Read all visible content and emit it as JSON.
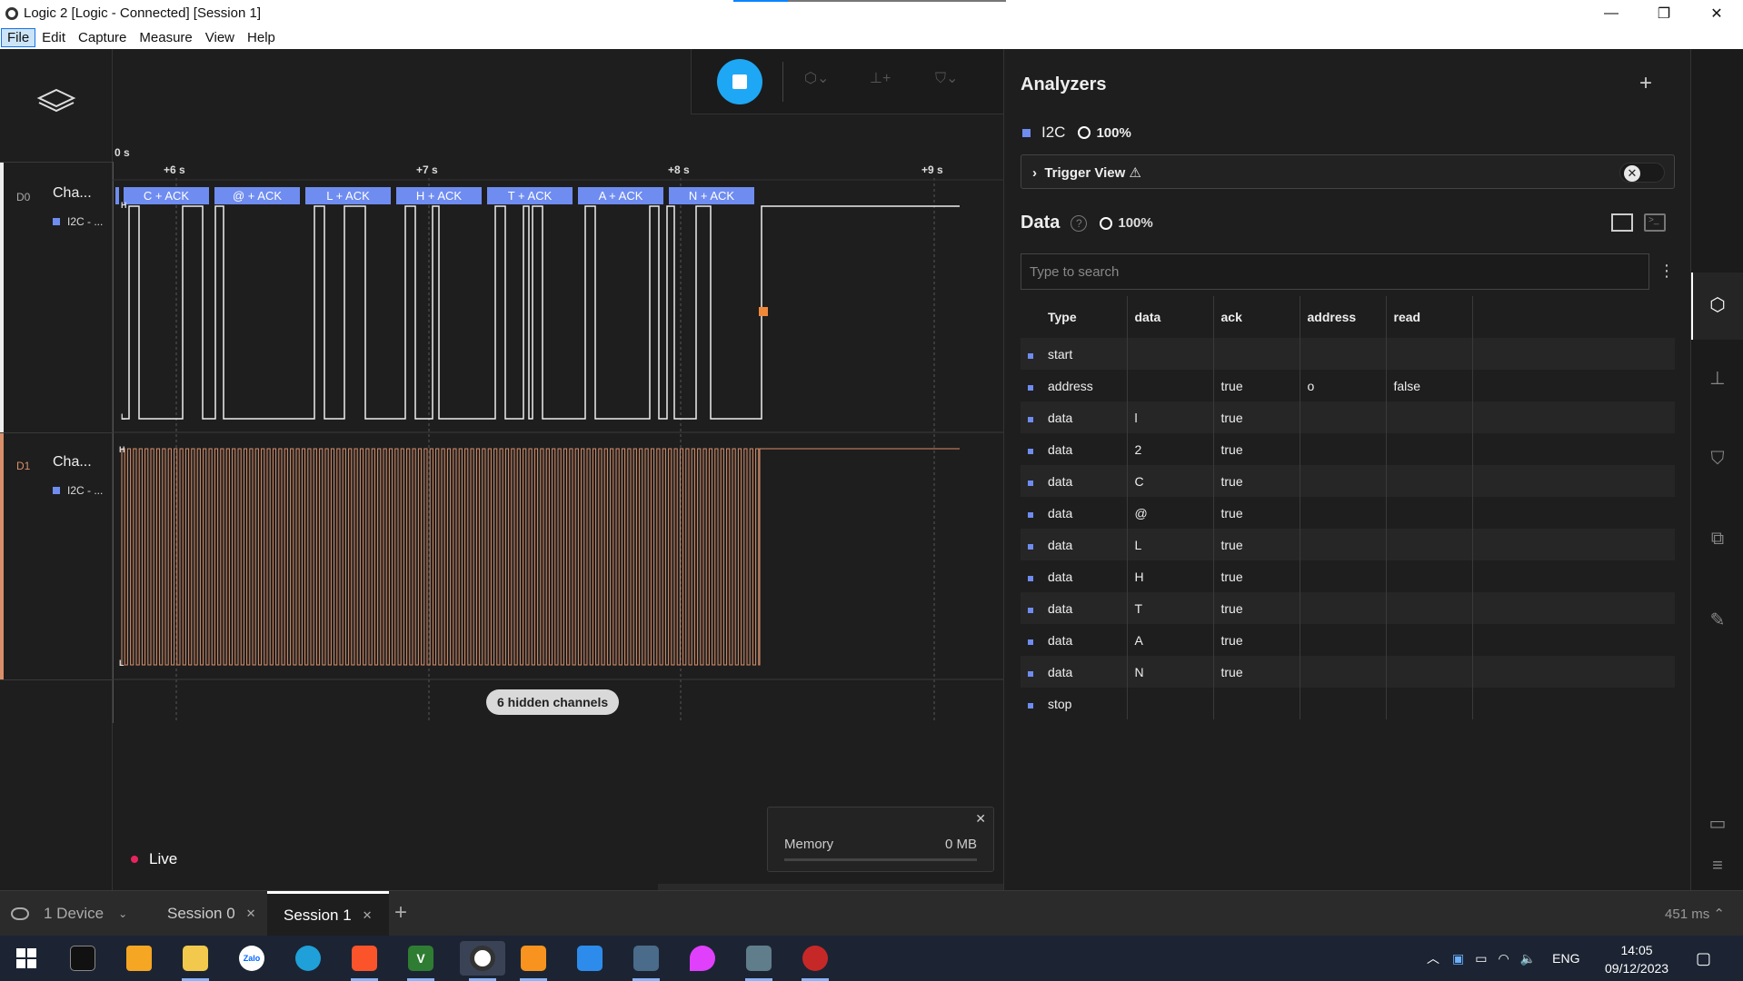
{
  "window": {
    "title": "Logic 2 [Logic - Connected] [Session 1]",
    "controls": [
      "—",
      "❐",
      "✕"
    ]
  },
  "menu": [
    "File",
    "Edit",
    "Capture",
    "Measure",
    "View",
    "Help"
  ],
  "timeline": {
    "origin_label": "0 s",
    "ticks": [
      "+6 s",
      "+7 s",
      "+8 s",
      "+9 s"
    ]
  },
  "channels": [
    {
      "id": "D0",
      "name": "Cha...",
      "analyzer": "I2C - ...",
      "color": "#ffffff"
    },
    {
      "id": "D1",
      "name": "Cha...",
      "analyzer": "I2C - ...",
      "color": "#d98f6a"
    }
  ],
  "decoded_frames": [
    "C + ACK",
    "@ + ACK",
    "L + ACK",
    "H + ACK",
    "T + ACK",
    "A + ACK",
    "N + ACK"
  ],
  "level_labels": {
    "high": "H",
    "low": "L"
  },
  "hidden_channels": "6 hidden channels",
  "live_label": "Live",
  "memory": {
    "label": "Memory",
    "value": "0 MB"
  },
  "analyzers": {
    "title": "Analyzers",
    "items": [
      {
        "name": "I2C",
        "progress": "100%"
      }
    ],
    "trigger_view": "Trigger View ⚠",
    "data_title": "Data",
    "data_progress": "100%",
    "search_placeholder": "Type to search",
    "columns": [
      "Type",
      "data",
      "ack",
      "address",
      "read"
    ],
    "rows": [
      [
        "start",
        "",
        "",
        "",
        ""
      ],
      [
        "address",
        "",
        "true",
        "o",
        "false"
      ],
      [
        "data",
        "l",
        "true",
        "",
        ""
      ],
      [
        "data",
        "2",
        "true",
        "",
        ""
      ],
      [
        "data",
        "C",
        "true",
        "",
        ""
      ],
      [
        "data",
        "@",
        "true",
        "",
        ""
      ],
      [
        "data",
        "L",
        "true",
        "",
        ""
      ],
      [
        "data",
        "H",
        "true",
        "",
        ""
      ],
      [
        "data",
        "T",
        "true",
        "",
        ""
      ],
      [
        "data",
        "A",
        "true",
        "",
        ""
      ],
      [
        "data",
        "N",
        "true",
        "",
        ""
      ],
      [
        "stop",
        "",
        "",
        "",
        ""
      ]
    ]
  },
  "session_bar": {
    "device": "1 Device",
    "tabs": [
      {
        "label": "Session 0",
        "active": false
      },
      {
        "label": "Session 1",
        "active": true
      }
    ],
    "timing": "451 ms"
  },
  "taskbar": {
    "apps": [
      "start-icon",
      "terminal-icon",
      "network-app-icon",
      "file-explorer-icon",
      "zalo-icon",
      "edge-icon",
      "brave-icon",
      "vs-app-icon",
      "logic-icon",
      "pdf-app-icon",
      "paint-app-icon",
      "remote-desktop-icon",
      "color-app-icon",
      "calculator-icon",
      "tool-icon"
    ],
    "app_labels": {
      "zalo": "Zalo",
      "vs": "V"
    },
    "lang": "ENG",
    "time": "14:05",
    "date": "09/12/2023"
  },
  "colors": {
    "accent": "#1ea7f5",
    "analyzer": "#6f8cf0",
    "d1": "#d98f6a",
    "marker": "#f0883a"
  }
}
